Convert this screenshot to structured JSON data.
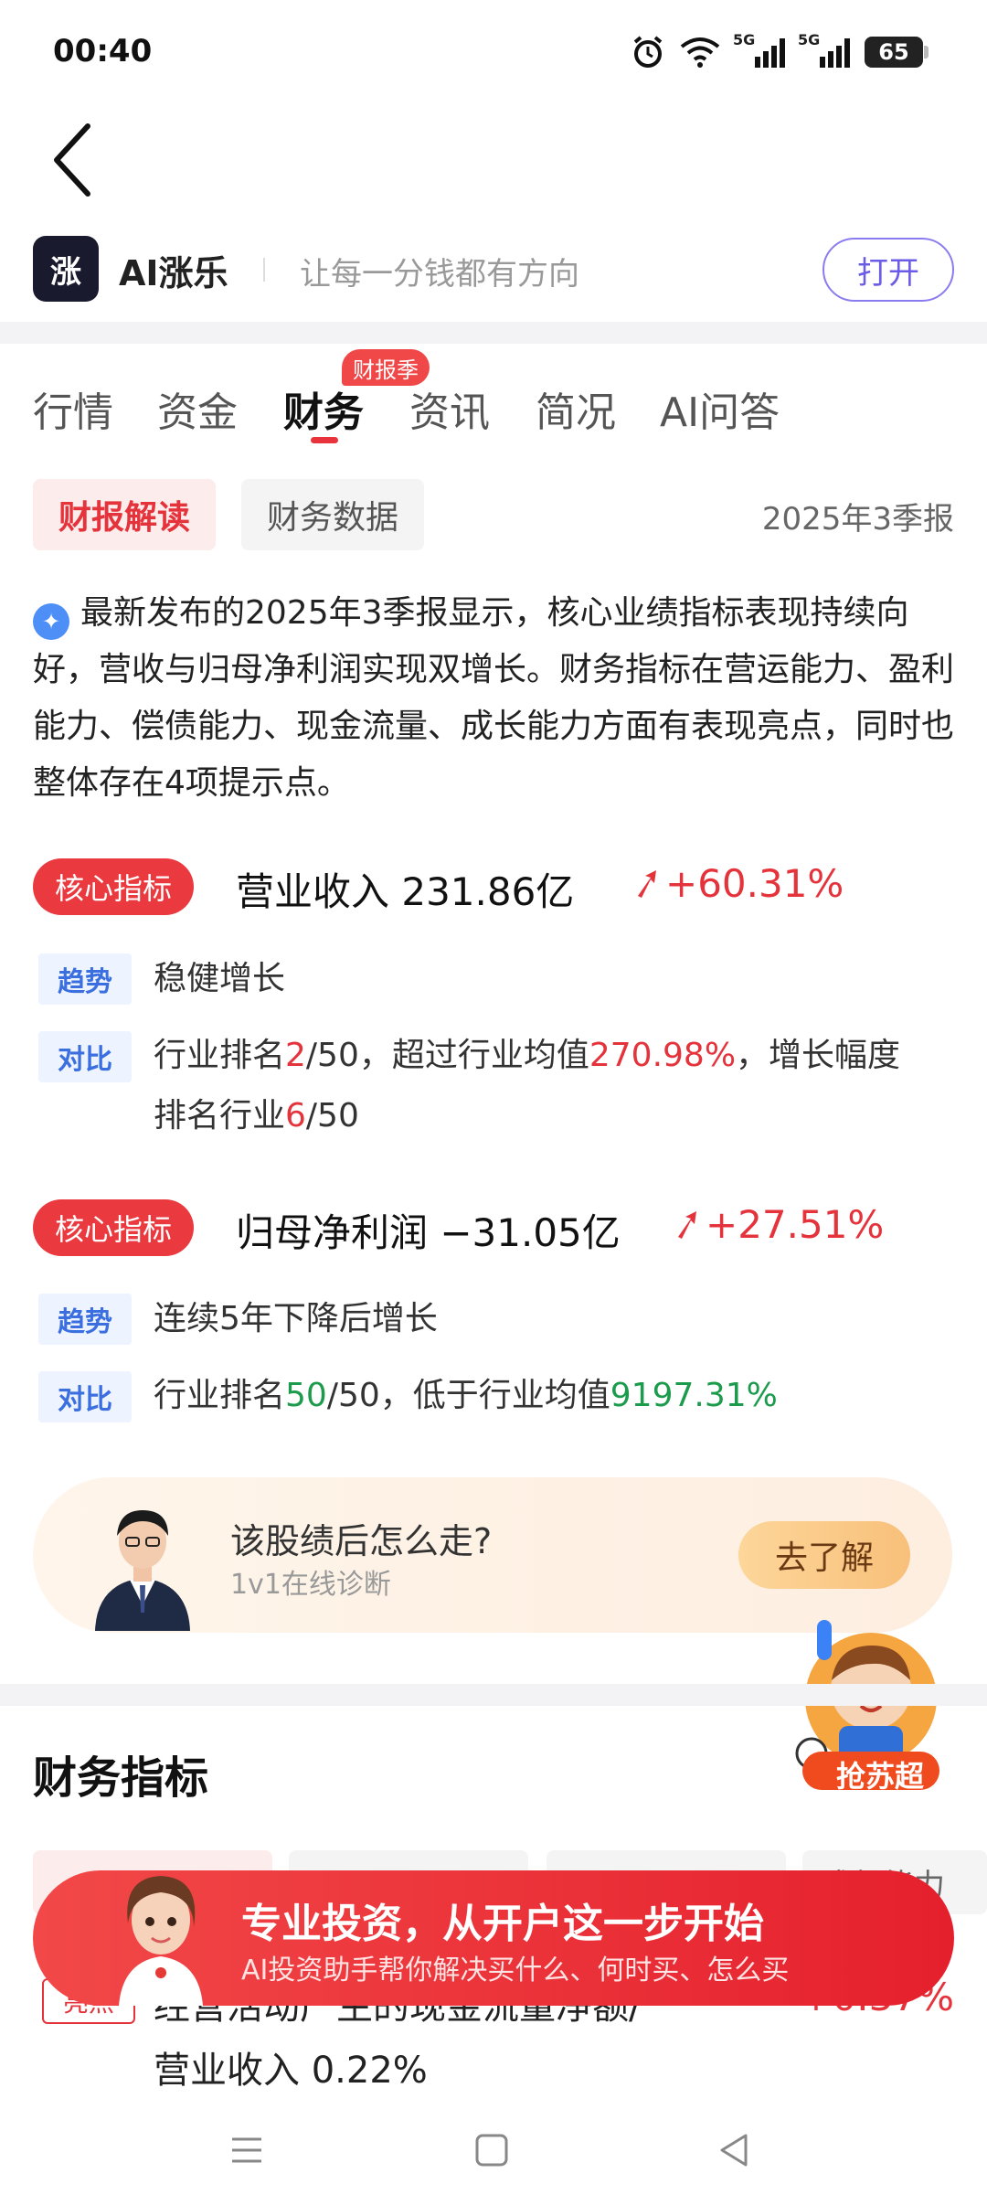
{
  "status": {
    "time": "00:40",
    "battery": "65",
    "net1": "5G",
    "net2": "5G"
  },
  "app": {
    "logo_text": "涨",
    "name": "AI涨乐",
    "slogan": "让每一分钱都有方向",
    "open_label": "打开"
  },
  "tabs": [
    {
      "label": "行情"
    },
    {
      "label": "资金"
    },
    {
      "label": "财务"
    },
    {
      "label": "资讯"
    },
    {
      "label": "简况"
    },
    {
      "label": "AI问答"
    }
  ],
  "tab_badge": "财报季",
  "subtabs": {
    "active": "财报解读",
    "inactive": "财务数据",
    "period": "2025年3季报"
  },
  "summary": "最新发布的2025年3季报显示，核心业绩指标表现持续向好，营收与归母净利润实现双增长。财务指标在营运能力、盈利能力、偿债能力、现金流量、成长能力方面有表现亮点，同时也整体存在4项提示点。",
  "metric1": {
    "tag": "核心指标",
    "title": "营业收入 231.86亿",
    "change": "+60.31%",
    "trend_tag": "趋势",
    "trend": "稳健增长",
    "compare_tag": "对比",
    "c1": "行业排名",
    "c_rank": "2",
    "c2": "/50，超过行业均值",
    "c_pct": "270.98%",
    "c3": "，增长幅度",
    "c4": "排名行业",
    "c_rank2": "6",
    "c5": "/50"
  },
  "metric2": {
    "tag": "核心指标",
    "title": "归母净利润 −31.05亿",
    "change": "+27.51%",
    "trend_tag": "趋势",
    "trend": "连续5年下降后增长",
    "compare_tag": "对比",
    "c1": "行业排名",
    "c_rank": "50",
    "c2": "/50，低于行业均值",
    "c_pct": "9197.31%"
  },
  "consult": {
    "title": "该股绩后怎么走?",
    "sub": "1v1在线诊断",
    "button": "去了解"
  },
  "mascot_label": "抢苏超",
  "section_title": "财务指标",
  "fin_tab_right": "成长能力",
  "promo": {
    "title": "专业投资，从开户这一步开始",
    "sub": "AI投资助手帮你解决买什么、何时买、怎么买"
  },
  "bottom": {
    "tag": "亮点",
    "line1": "经营活动产生的现金流量净额/",
    "line2": "营业收入 0.22%",
    "change": "+0.37%"
  },
  "colors": {
    "accent_red": "#e5333c",
    "green": "#1c9b4d",
    "blue": "#3b6fe0",
    "open_purple": "#6b5ce7"
  }
}
